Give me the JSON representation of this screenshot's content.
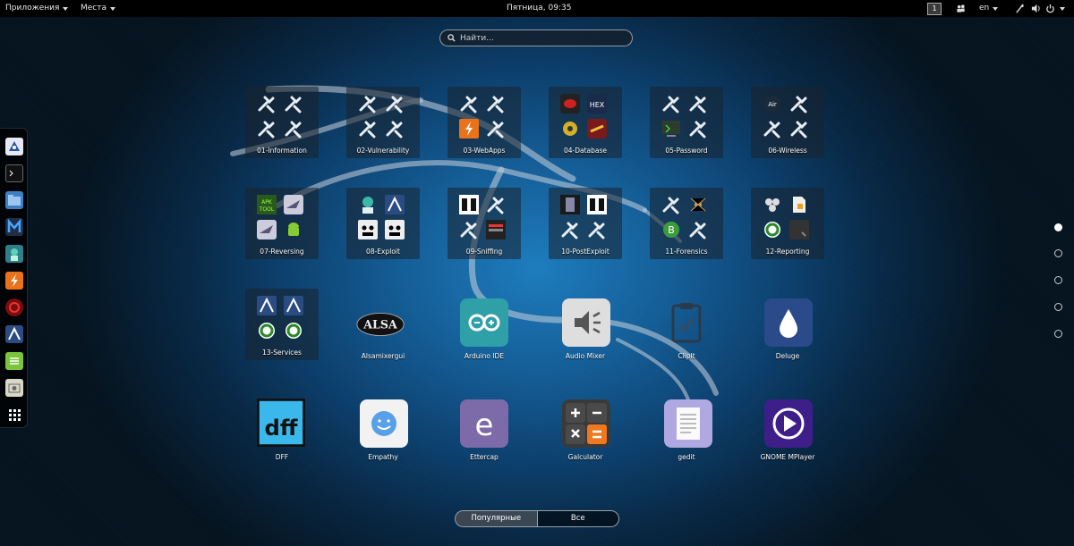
{
  "topbar": {
    "applications": "Приложения",
    "places": "Места",
    "clock": "Пятница, 09:35",
    "workspace": "1",
    "language": "en"
  },
  "search": {
    "placeholder": "Найти..."
  },
  "dash": {
    "items": [
      "kali-menu-icon",
      "terminal-icon",
      "files-icon",
      "metasploit-icon",
      "armitage-icon",
      "burpsuite-icon",
      "faraday-icon",
      "maltego-icon",
      "notes-icon",
      "screenshot-icon",
      "show-apps-icon"
    ]
  },
  "folders": [
    {
      "label": "01-Information"
    },
    {
      "label": "02-Vulnerability"
    },
    {
      "label": "03-WebApps"
    },
    {
      "label": "04-Database"
    },
    {
      "label": "05-Password"
    },
    {
      "label": "06-Wireless"
    },
    {
      "label": "07-Reversing"
    },
    {
      "label": "08-Exploit"
    },
    {
      "label": "09-Sniffing"
    },
    {
      "label": "10-PostExploit"
    },
    {
      "label": "11-Forensics"
    },
    {
      "label": "12-Reporting"
    },
    {
      "label": "13-Services"
    }
  ],
  "apps": [
    {
      "label": "Alsamixergui",
      "color": "#000000"
    },
    {
      "label": "Arduino IDE",
      "color": "#2fa0a8"
    },
    {
      "label": "Audio Mixer",
      "color": "#d8d8d8"
    },
    {
      "label": "ClipIt",
      "color": "#3a4a5a"
    },
    {
      "label": "Deluge",
      "color": "#2b4a8a"
    },
    {
      "label": "DFF",
      "color": "#3ab8ec"
    },
    {
      "label": "Empathy",
      "color": "#f2f2f2"
    },
    {
      "label": "Ettercap",
      "color": "#7d6aa8"
    },
    {
      "label": "Galculator",
      "color": "#3a3a3a"
    },
    {
      "label": "gedit",
      "color": "#b0a8e0"
    },
    {
      "label": "GNOME MPlayer",
      "color": "#3e1f8a"
    }
  ],
  "view_toggle": {
    "popular": "Популярные",
    "all": "Все",
    "selected": "popular"
  },
  "pagination": {
    "pages": 5,
    "current": 1
  }
}
